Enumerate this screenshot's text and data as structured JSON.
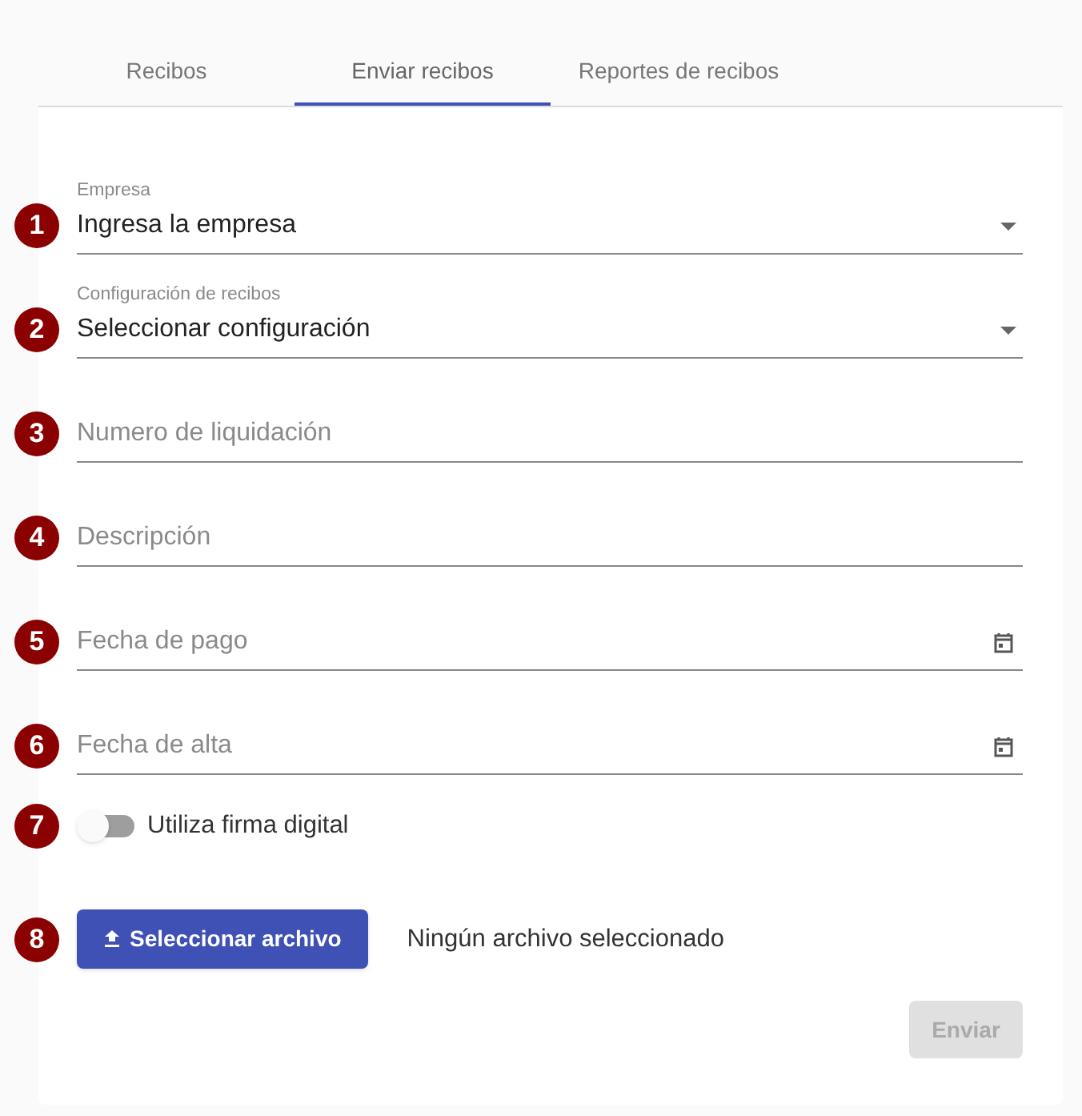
{
  "tabs": [
    {
      "label": "Recibos",
      "selected": false
    },
    {
      "label": "Enviar recibos",
      "selected": true
    },
    {
      "label": "Reportes de recibos",
      "selected": false
    }
  ],
  "fields": [
    {
      "number": "1",
      "kind": "select",
      "label": "Empresa",
      "value": "Ingresa la empresa"
    },
    {
      "number": "2",
      "kind": "select",
      "label": "Configuración de recibos",
      "value": "Seleccionar configuración"
    },
    {
      "number": "3",
      "kind": "text",
      "placeholder": "Numero de liquidación"
    },
    {
      "number": "4",
      "kind": "text",
      "placeholder": "Descripción"
    },
    {
      "number": "5",
      "kind": "date",
      "placeholder": "Fecha de pago"
    },
    {
      "number": "6",
      "kind": "date",
      "placeholder": "Fecha de alta"
    }
  ],
  "toggle": {
    "number": "7",
    "label": "Utiliza firma digital",
    "on": false
  },
  "file": {
    "number": "8",
    "button": "Seleccionar archivo",
    "status": "Ningún archivo seleccionado"
  },
  "submit": {
    "label": "Enviar",
    "disabled": true
  }
}
